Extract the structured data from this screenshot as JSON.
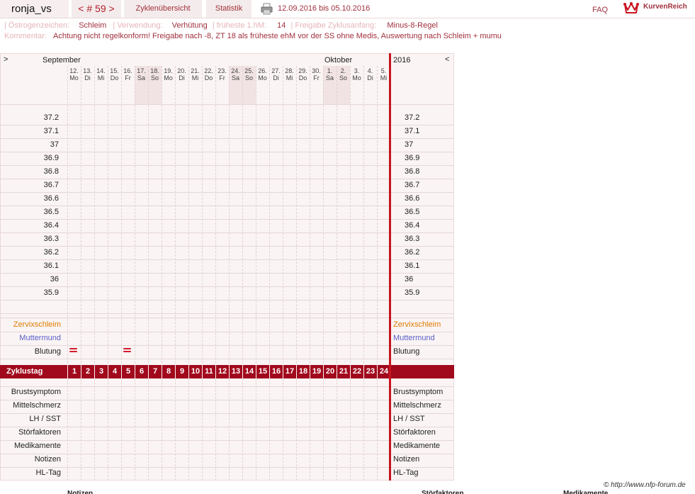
{
  "header": {
    "user": "ronja_vs",
    "cycle": "< # 59 >",
    "tabs": [
      "Zyklenübersicht",
      "Statistik"
    ],
    "date_range": "12.09.2016 bis 05.10.2016",
    "faq": "FAQ",
    "logo": "KurvenReich"
  },
  "info": {
    "oestrogen_label": "Östrogenzeichen:",
    "oestrogen_value": "Schleim",
    "verwendung_label": "Verwendung:",
    "verwendung_value": "Verhütung",
    "hm_label": "früheste 1.hM:",
    "hm_value": "14",
    "freigabe_label": "Freigabe Zyklusanfang:",
    "freigabe_value": "Minus-8-Regel",
    "kommentar_label": "Kommentar:",
    "kommentar_value": "Achtung nicht regelkonform! Freigabe nach -8, ZT 18 als früheste ehM vor der SS ohne Medis, Auswertung nach Schleim + mumu"
  },
  "chart": {
    "nav_left": ">",
    "nav_right": "<",
    "months": [
      {
        "name": "September",
        "day_index": 0
      },
      {
        "name": "Oktober",
        "day_index": 19
      }
    ],
    "year": "2016",
    "days": [
      {
        "d": "12.",
        "w": "Mo"
      },
      {
        "d": "13.",
        "w": "Di"
      },
      {
        "d": "14.",
        "w": "Mi"
      },
      {
        "d": "15.",
        "w": "Do"
      },
      {
        "d": "16.",
        "w": "Fr"
      },
      {
        "d": "17.",
        "w": "Sa"
      },
      {
        "d": "18.",
        "w": "So"
      },
      {
        "d": "19.",
        "w": "Mo"
      },
      {
        "d": "20.",
        "w": "Di"
      },
      {
        "d": "21.",
        "w": "Mi"
      },
      {
        "d": "22.",
        "w": "Do"
      },
      {
        "d": "23.",
        "w": "Fr"
      },
      {
        "d": "24.",
        "w": "Sa"
      },
      {
        "d": "25.",
        "w": "So"
      },
      {
        "d": "26.",
        "w": "Mo"
      },
      {
        "d": "27.",
        "w": "Di"
      },
      {
        "d": "28.",
        "w": "Mi"
      },
      {
        "d": "29.",
        "w": "Do"
      },
      {
        "d": "30.",
        "w": "Fr"
      },
      {
        "d": "1.",
        "w": "Sa"
      },
      {
        "d": "2.",
        "w": "So"
      },
      {
        "d": "3.",
        "w": "Mo"
      },
      {
        "d": "4.",
        "w": "Di"
      },
      {
        "d": "5.",
        "w": "Mi"
      }
    ],
    "temperatures": [
      "37.2",
      "37.1",
      "37",
      "36.9",
      "36.8",
      "36.7",
      "36.6",
      "36.5",
      "36.4",
      "36.3",
      "36.2",
      "36.1",
      "36",
      "35.9"
    ],
    "rows_top": [
      {
        "label": "Zervixschleim",
        "color": "#e07b00"
      },
      {
        "label": "Muttermund",
        "color": "#5a5fc8"
      },
      {
        "label": "Blutung",
        "color": "#222222"
      }
    ],
    "bleeding_days": [
      1,
      5
    ],
    "zyklustag_label": "Zyklustag",
    "cycle_days": [
      "1",
      "2",
      "3",
      "4",
      "5",
      "6",
      "7",
      "8",
      "9",
      "10",
      "11",
      "12",
      "13",
      "14",
      "15",
      "16",
      "17",
      "18",
      "19",
      "20",
      "21",
      "22",
      "23",
      "24"
    ],
    "rows_bottom": [
      "Brustsymptom",
      "Mittelschmerz",
      "LH / SST",
      "Störfaktoren",
      "Medikamente",
      "Notizen",
      "HL-Tag"
    ]
  },
  "footer": {
    "copyright": "© http://www.nfp-forum.de",
    "col_notizen": "Notizen",
    "col_stoerfaktoren": "Störfaktoren",
    "col_medikamente": "Medikamente"
  }
}
